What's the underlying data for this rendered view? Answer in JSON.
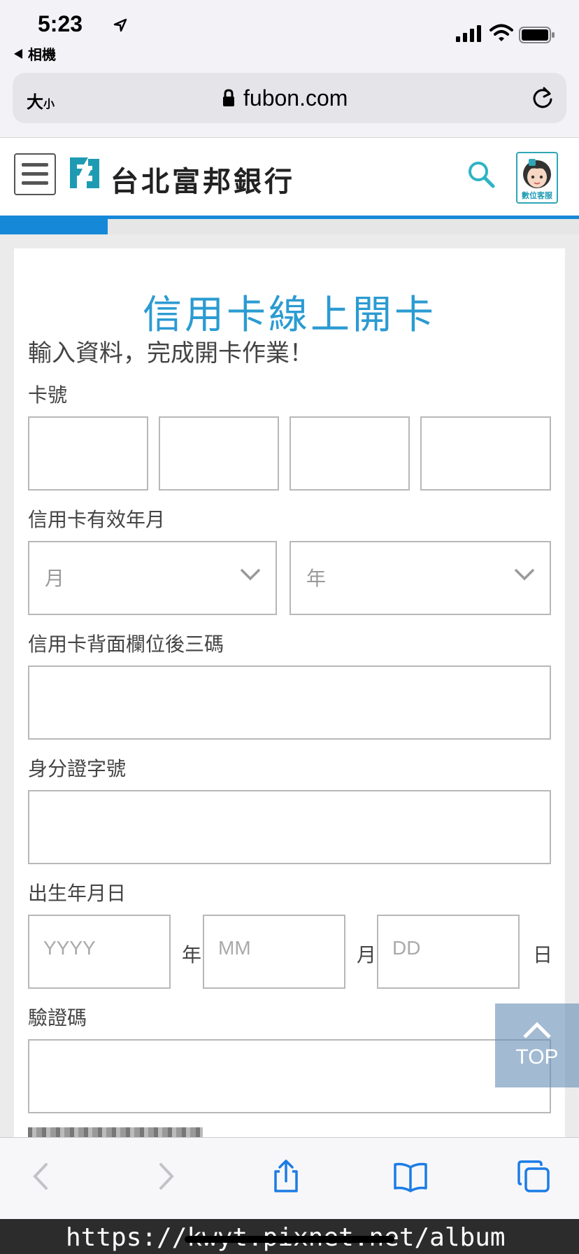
{
  "status_bar": {
    "time": "5:23",
    "back_app": "相機"
  },
  "browser": {
    "text_size_label": "大",
    "text_size_small": "小",
    "url": "fubon.com"
  },
  "header": {
    "brand": "台北富邦銀行",
    "cs_label": "數位客服"
  },
  "progress": {
    "fraction": 0.186
  },
  "form": {
    "title": "信用卡線上開卡",
    "subtitle": "輸入資料，完成開卡作業！",
    "card_number_label": "卡號",
    "expiry_label": "信用卡有效年月",
    "expiry_month_placeholder": "月",
    "expiry_year_placeholder": "年",
    "cvv_label": "信用卡背面欄位後三碼",
    "id_label": "身分證字號",
    "birth_label": "出生年月日",
    "birth_year_placeholder": "YYYY",
    "birth_year_unit": "年",
    "birth_month_placeholder": "MM",
    "birth_month_unit": "月",
    "birth_day_placeholder": "DD",
    "birth_day_unit": "日",
    "captcha_label": "驗證碼"
  },
  "top_button": {
    "label": "TOP"
  },
  "watermark": "https://kwyt.pixnet.net/album",
  "colors": {
    "accent": "#1688d8",
    "title": "#2b9bd2",
    "logo": "#1e9bb3"
  }
}
